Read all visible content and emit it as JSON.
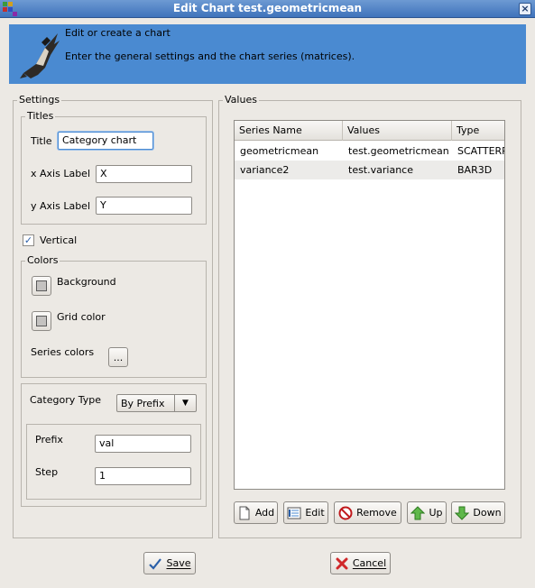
{
  "window": {
    "title": "Edit Chart test.geometricmean",
    "close_glyph": "×"
  },
  "banner": {
    "line1": "Edit or create a chart",
    "line2": "Enter the general settings and the chart series (matrices).",
    "logo_icon": "bird-logo-icon",
    "color": "#4a8ad1"
  },
  "settings": {
    "legend": "Settings",
    "titles": {
      "legend": "Titles",
      "title_label": "Title",
      "title_value": "Category chart",
      "x_label": "x Axis Label",
      "x_value": "X",
      "y_label": "y Axis Label",
      "y_value": "Y"
    },
    "vertical": {
      "label": "Vertical",
      "checked": true
    },
    "colors": {
      "legend": "Colors",
      "background_label": "Background",
      "grid_label": "Grid color",
      "series_label": "Series colors",
      "series_button": "..."
    },
    "category": {
      "type_label": "Category Type",
      "type_value": "By Prefix",
      "prefix_label": "Prefix",
      "prefix_value": "val",
      "step_label": "Step",
      "step_value": "1"
    }
  },
  "values": {
    "legend": "Values",
    "columns": [
      "Series Name",
      "Values",
      "Type"
    ],
    "rows": [
      [
        "geometricmean",
        "test.geometricmean",
        "SCATTERPLOT"
      ],
      [
        "variance2",
        "test.variance",
        "BAR3D"
      ]
    ],
    "buttons": {
      "add": "Add",
      "edit": "Edit",
      "remove": "Remove",
      "up": "Up",
      "down": "Down"
    }
  },
  "footer": {
    "save": "Save",
    "cancel": "Cancel"
  }
}
